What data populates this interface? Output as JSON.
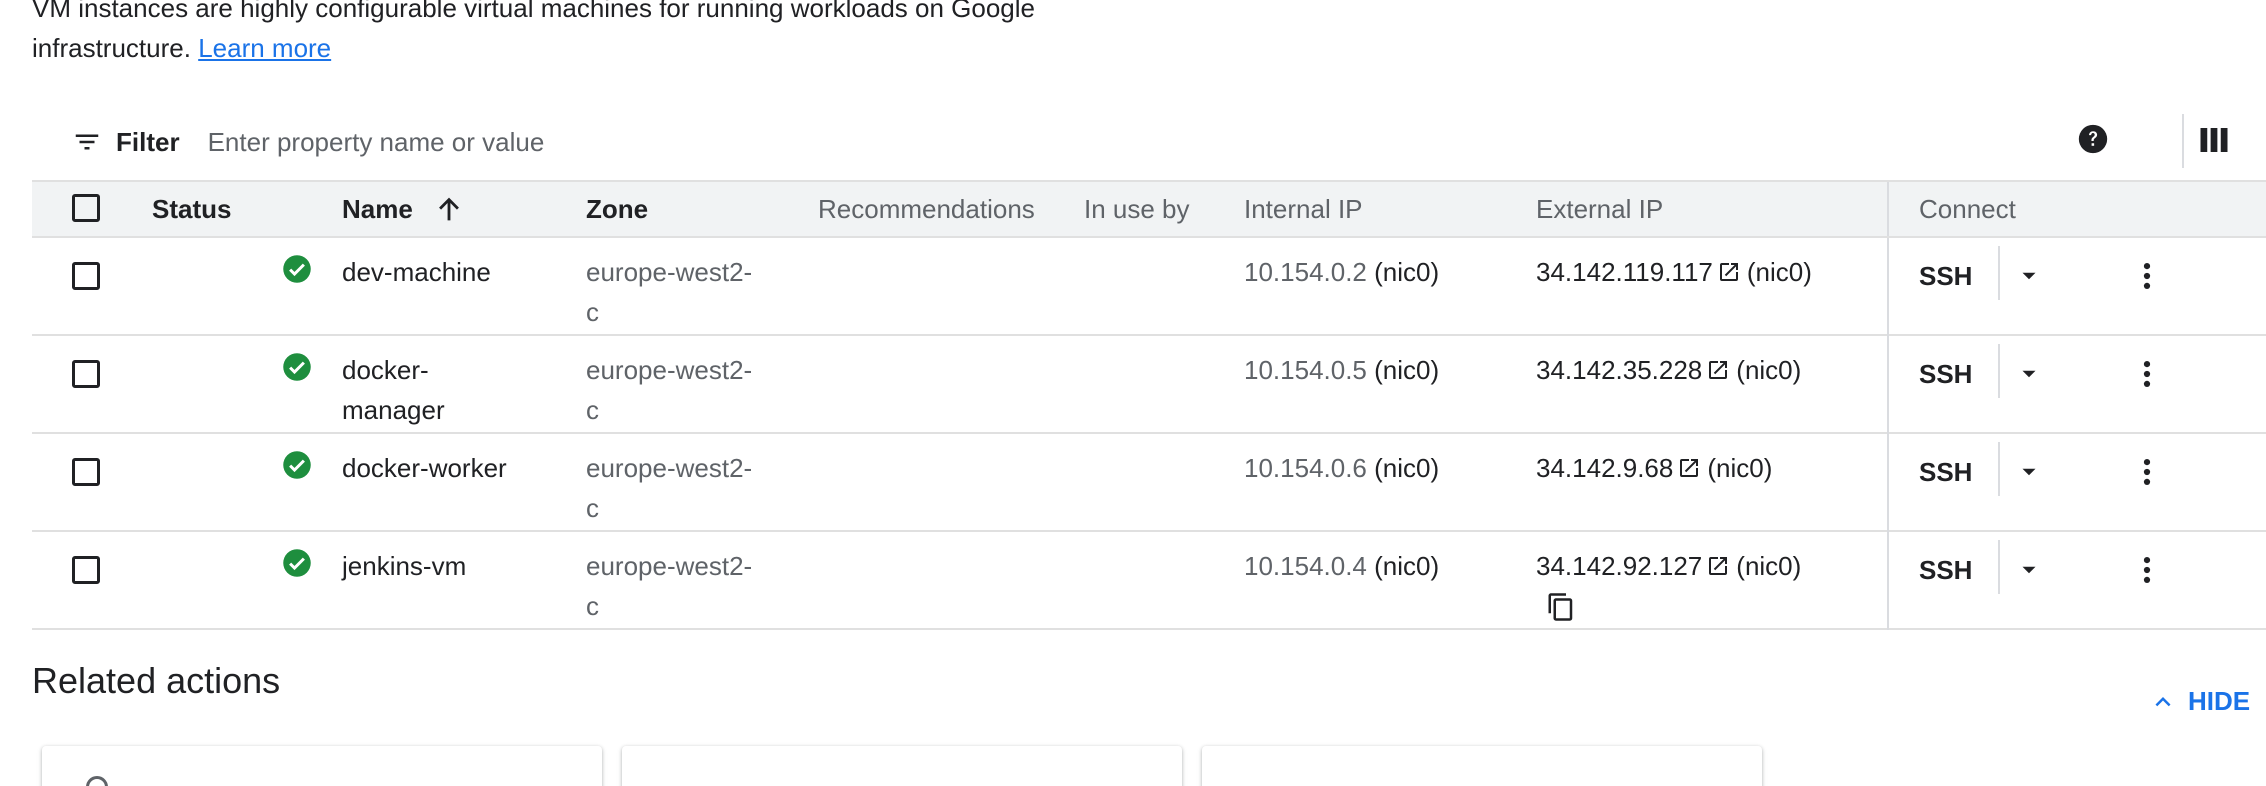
{
  "intro": {
    "text_line1": "VM instances are highly configurable virtual machines for running workloads on Google",
    "text_line2": "infrastructure.",
    "learn_more": "Learn more"
  },
  "filter": {
    "label": "Filter",
    "placeholder": "Enter property name or value"
  },
  "table": {
    "columns": {
      "status": "Status",
      "name": "Name",
      "zone": "Zone",
      "recommendations": "Recommendations",
      "in_use_by": "In use by",
      "internal_ip": "Internal IP",
      "external_ip": "External IP",
      "connect": "Connect"
    },
    "sort": {
      "column": "Name",
      "direction": "ascending"
    },
    "rows": [
      {
        "name_line1": "dev-machine",
        "name_line2": "",
        "zone_line1": "europe-west2-",
        "zone_line2": "c",
        "internal_ip": "10.154.0.2",
        "internal_nic": "(nic0)",
        "external_ip": "34.142.119.117",
        "external_nic": "(nic0)",
        "connect": "SSH",
        "status": "running"
      },
      {
        "name_line1": "docker-",
        "name_line2": "manager",
        "zone_line1": "europe-west2-",
        "zone_line2": "c",
        "internal_ip": "10.154.0.5",
        "internal_nic": "(nic0)",
        "external_ip": "34.142.35.228",
        "external_nic": "(nic0)",
        "connect": "SSH",
        "status": "running"
      },
      {
        "name_line1": "docker-worker",
        "name_line2": "",
        "zone_line1": "europe-west2-",
        "zone_line2": "c",
        "internal_ip": "10.154.0.6",
        "internal_nic": "(nic0)",
        "external_ip": "34.142.9.68",
        "external_nic": "(nic0)",
        "connect": "SSH",
        "status": "running"
      },
      {
        "name_line1": "jenkins-vm",
        "name_line2": "",
        "zone_line1": "europe-west2-",
        "zone_line2": "c",
        "internal_ip": "10.154.0.4",
        "internal_nic": "(nic0)",
        "external_ip": "34.142.92.127",
        "external_nic": "(nic0)",
        "connect": "SSH",
        "status": "running"
      }
    ]
  },
  "related": {
    "title": "Related actions",
    "hide_label": "HIDE"
  },
  "icons": {
    "filter": "filter-list-icon",
    "help": "help-icon",
    "columns": "column-display-icon",
    "status_ok": "check-circle-icon",
    "sort": "arrow-upward-icon",
    "external_link": "open-in-new-icon",
    "copy": "copy-icon",
    "dropdown": "arrow-drop-down-icon",
    "more": "more-vert-icon",
    "hide": "chevron-up-icon"
  },
  "colors": {
    "accent": "#1a73e8",
    "status_ok": "#1e8e3e",
    "header_bg": "#f1f3f4",
    "text_primary": "#202124",
    "text_secondary": "#5f6368"
  }
}
